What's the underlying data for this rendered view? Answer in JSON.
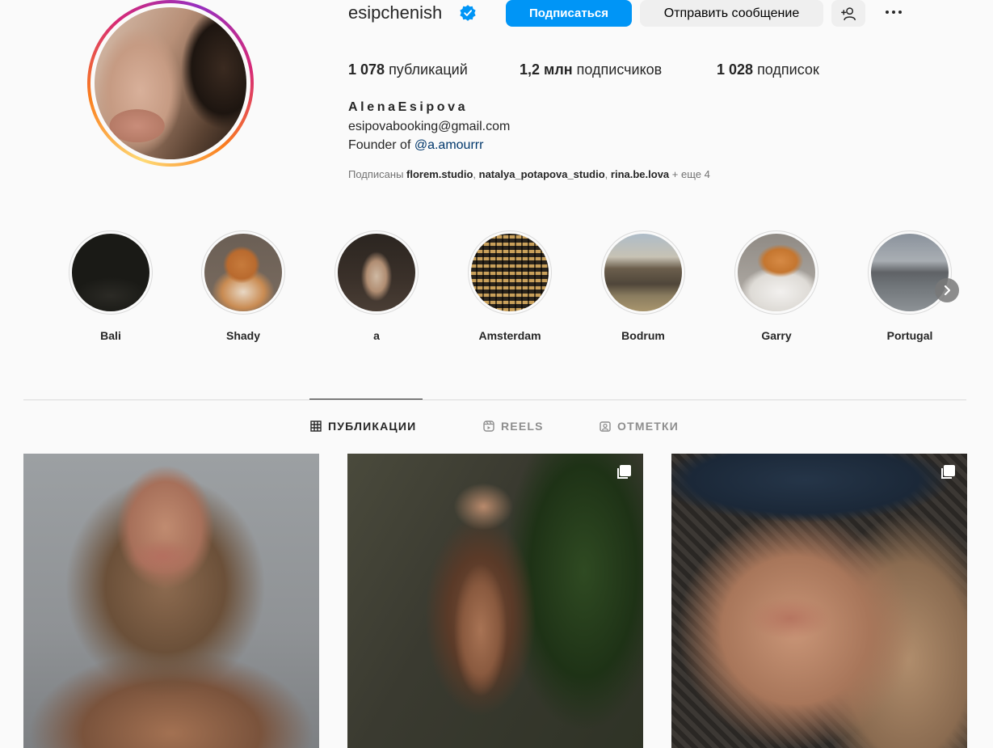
{
  "profile": {
    "username": "esipchenish",
    "follow_label": "Подписаться",
    "message_label": "Отправить сообщение",
    "stats": [
      {
        "value": "1 078",
        "label": "публикаций"
      },
      {
        "value": "1,2 млн",
        "label": "подписчиков"
      },
      {
        "value": "1 028",
        "label": "подписок"
      }
    ],
    "full_name": "AlenaEsipova",
    "bio_email": "esipovabooking@gmail.com",
    "bio_prefix": "Founder of ",
    "bio_link": "@a.amourrr",
    "followed_prefix": "Подписаны ",
    "followed_users": [
      "florem.studio",
      "natalya_potapova_studio",
      "rina.be.lova"
    ],
    "followed_more": "+ еще 4"
  },
  "highlights": [
    {
      "label": "Bali"
    },
    {
      "label": "Shady"
    },
    {
      "label": "a"
    },
    {
      "label": "Amsterdam"
    },
    {
      "label": "Bodrum"
    },
    {
      "label": "Garry"
    },
    {
      "label": "Portugal"
    }
  ],
  "tabs": [
    {
      "label": "ПУБЛИКАЦИИ",
      "active": true
    },
    {
      "label": "REELS",
      "active": false
    },
    {
      "label": "ОТМЕТКИ",
      "active": false
    }
  ],
  "colors": {
    "accent": "#0095f6",
    "verified": "#0095f6",
    "link": "#00376b",
    "text": "#262626",
    "muted": "#737373"
  }
}
